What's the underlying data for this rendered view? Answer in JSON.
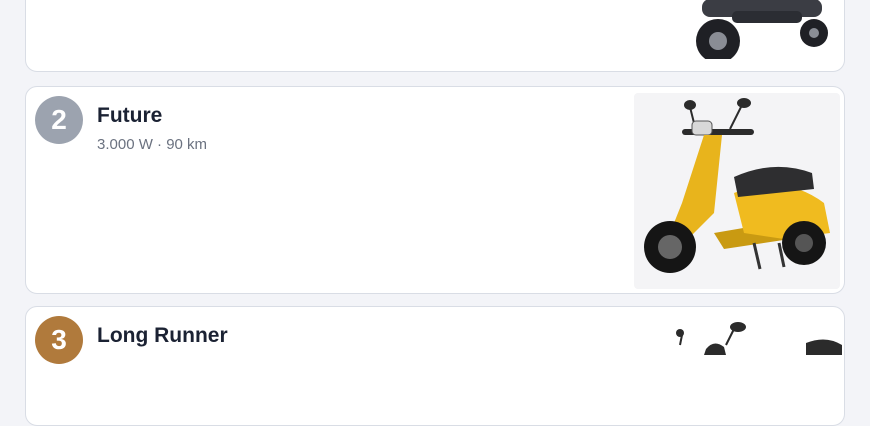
{
  "items": [
    {
      "rank": "",
      "title": "",
      "meta": "",
      "badge_color": "#9ca3af",
      "image": "dark-scooter-image"
    },
    {
      "rank": "2",
      "title": "Future",
      "meta": "3.000 W · 90 km",
      "badge_color": "#9ca3af",
      "image": "yellow-scooter-image"
    },
    {
      "rank": "3",
      "title": "Long Runner",
      "meta": "",
      "badge_color": "#b07a3c",
      "image": "scooter-mirror-image"
    }
  ]
}
